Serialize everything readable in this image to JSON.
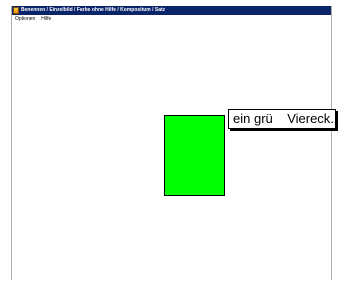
{
  "window": {
    "title": "Benennen / Einzelbild / Farbe ohne Hilfe / Kompositum / Satz"
  },
  "menu": {
    "items": [
      {
        "label": "Optionen"
      },
      {
        "label": "Hilfe"
      }
    ]
  },
  "stimulus": {
    "shape": "rectangle",
    "color": "#00ff00",
    "caption": "ein grü    Viereck."
  },
  "icons": {
    "app": "app-icon"
  }
}
